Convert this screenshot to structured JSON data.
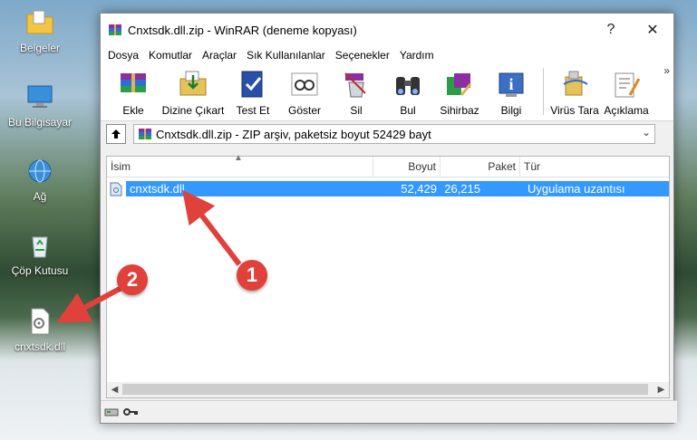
{
  "desktop": {
    "icons": [
      {
        "label": "Belgeler",
        "icon": "folder-icon"
      },
      {
        "label": "Bu Bilgisayar",
        "icon": "computer-icon"
      },
      {
        "label": "Ağ",
        "icon": "network-icon"
      },
      {
        "label": "Çöp Kutusu",
        "icon": "recycle-bin-icon"
      },
      {
        "label": "cnxtsdk.dll",
        "icon": "dll-file-icon"
      }
    ]
  },
  "window": {
    "title": "Cnxtsdk.dll.zip - WinRAR (deneme kopyası)",
    "help_label": "?",
    "close_label": "✕"
  },
  "menu": [
    "Dosya",
    "Komutlar",
    "Araçlar",
    "Sık Kullanılanlar",
    "Seçenekler",
    "Yardım"
  ],
  "toolbar": {
    "buttons": [
      {
        "label": "Ekle",
        "icon": "add-archive-icon"
      },
      {
        "label": "Dizine Çıkart",
        "icon": "extract-to-icon"
      },
      {
        "label": "Test Et",
        "icon": "test-icon"
      },
      {
        "label": "Göster",
        "icon": "view-icon"
      },
      {
        "label": "Sil",
        "icon": "delete-icon"
      },
      {
        "label": "Bul",
        "icon": "find-icon"
      },
      {
        "label": "Sihirbaz",
        "icon": "wizard-icon"
      },
      {
        "label": "Bilgi",
        "icon": "info-icon"
      },
      {
        "label": "Virüs Tara",
        "icon": "virus-scan-icon"
      },
      {
        "label": "Açıklama",
        "icon": "comment-icon"
      }
    ],
    "more_label": "»"
  },
  "address": {
    "text": "Cnxtsdk.dll.zip - ZIP arşiv, paketsiz boyut 52429 bayt"
  },
  "list": {
    "columns": [
      "İsim",
      "Boyut",
      "Paket",
      "Tür"
    ],
    "rows": [
      {
        "name": "cnxtsdk.dll",
        "size": "52,429",
        "packed": "26,215",
        "type": "Uygulama uzantısı"
      }
    ]
  },
  "annotations": [
    "1",
    "2"
  ],
  "colors": {
    "selection": "#3399ff",
    "marker": "#e0413a",
    "arrow": "#e0413a"
  }
}
